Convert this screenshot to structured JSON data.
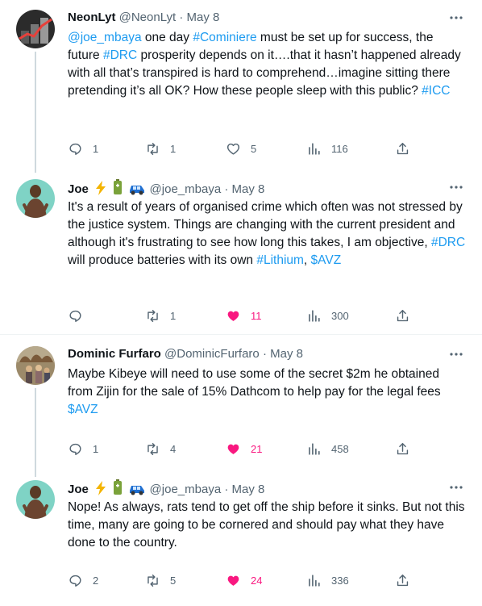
{
  "tweets": [
    {
      "name": "NeonLyt",
      "handle": "@NeonLyt",
      "sep": "·",
      "date": "May 8",
      "badges": [],
      "body": [
        {
          "t": "@joe_mbaya",
          "link": true
        },
        {
          "t": " one day ",
          "link": false
        },
        {
          "t": "#Cominiere",
          "link": true
        },
        {
          "t": " must be set up for success, the future ",
          "link": false
        },
        {
          "t": "#DRC",
          "link": true
        },
        {
          "t": " prosperity depends on it….that it hasn’t happened already with all that’s transpired is hard to comprehend…imagine sitting there pretending it’s all OK?  How these people sleep with this public?  ",
          "link": false
        },
        {
          "t": "#ICC",
          "link": true
        }
      ],
      "replies": "1",
      "retweets": "1",
      "likes": "5",
      "views": "116",
      "liked": false
    },
    {
      "name": "Joe",
      "handle": "@joe_mbaya",
      "sep": "·",
      "date": "May 8",
      "badges": [
        "lightning",
        "battery",
        "car"
      ],
      "body": [
        {
          "t": "It's a result of years of organised crime which often was not stressed by the justice system. Things are changing with the current president and although it's frustrating to see how long this takes,  I am objective, ",
          "link": false
        },
        {
          "t": "#DRC",
          "link": true
        },
        {
          "t": " will produce batteries with its own ",
          "link": false
        },
        {
          "t": "#Lithium",
          "link": true
        },
        {
          "t": ", ",
          "link": false
        },
        {
          "t": "$AVZ",
          "link": true
        }
      ],
      "replies": "",
      "retweets": "1",
      "likes": "11",
      "views": "300",
      "liked": true
    },
    {
      "name": "Dominic Furfaro",
      "handle": "@DominicFurfaro",
      "sep": "·",
      "date": "May 8",
      "badges": [],
      "body": [
        {
          "t": "Maybe Kibeye will need to use some of the secret $2m he obtained from Zijin for the sale of 15% Dathcom to help pay for the legal fees ",
          "link": false
        },
        {
          "t": "$AVZ",
          "link": true
        }
      ],
      "replies": "1",
      "retweets": "4",
      "likes": "21",
      "views": "458",
      "liked": true
    },
    {
      "name": "Joe",
      "handle": "@joe_mbaya",
      "sep": "·",
      "date": "May 8",
      "badges": [
        "lightning",
        "battery",
        "car"
      ],
      "body": [
        {
          "t": "Nope! As always, rats tend to get off the ship before it sinks. But not this time, many are going to be cornered and should pay what they have done to the country.",
          "link": false
        }
      ],
      "replies": "2",
      "retweets": "5",
      "likes": "24",
      "views": "336",
      "liked": true
    }
  ],
  "colors": {
    "link": "#1d9bf0",
    "like_active": "#f91880",
    "muted": "#536471",
    "text": "#0f1419"
  }
}
